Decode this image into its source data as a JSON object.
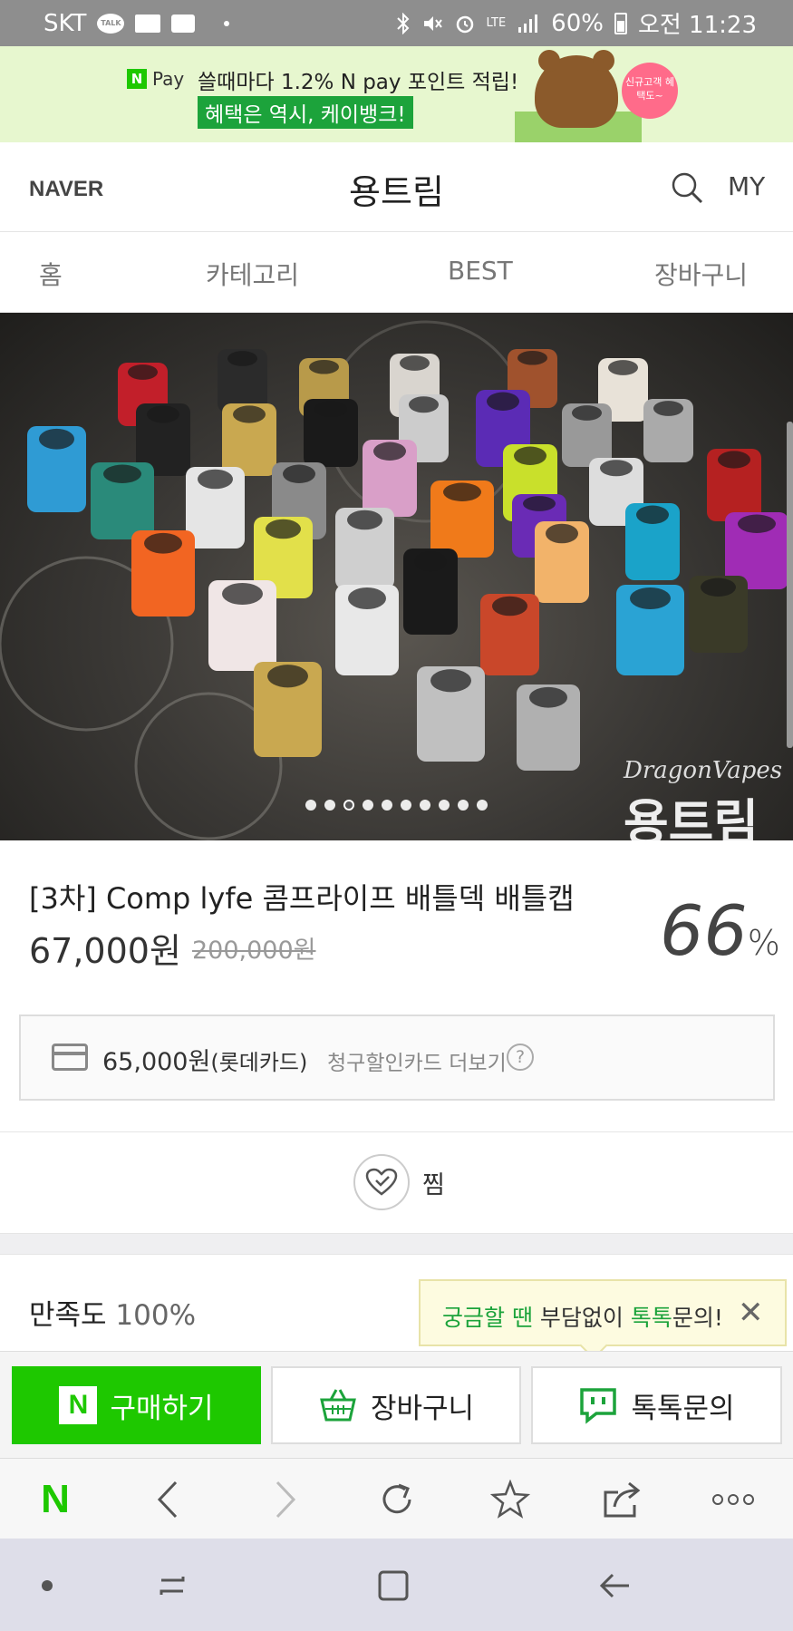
{
  "status_bar": {
    "carrier": "SKT",
    "talk_badge": "TALK",
    "network": "LTE",
    "battery": "60%",
    "time": "오전 11:23"
  },
  "ad_banner": {
    "npay_label": "Pay",
    "npay_n": "N",
    "line1": "쓸때마다 1.2% N pay 포인트 적립!",
    "line2": "혜택은 역시, 케이뱅크!",
    "bubble": "신규고객 혜택도~"
  },
  "header": {
    "logo": "NAVER",
    "title": "용트림",
    "my_label": "MY"
  },
  "nav_tabs": [
    {
      "label": "홈"
    },
    {
      "label": "카테고리"
    },
    {
      "label": "BEST"
    },
    {
      "label": "장바구니"
    }
  ],
  "hero": {
    "watermark_en": "DragonVapes",
    "watermark_ko": "용트림",
    "dot_count": 10,
    "active_dot": 3
  },
  "product": {
    "name": "[3차] Comp lyfe 콤프라이프 배틀덱 배틀캡",
    "price": "67,000원",
    "original_price": "200,000원",
    "discount": "66",
    "discount_unit": "%"
  },
  "card_promo": {
    "amount": "65,000원",
    "card_name": "(롯데카드)",
    "more_label": "청구할인카드 더보기",
    "help": "?"
  },
  "wish": {
    "label": "찜"
  },
  "satisfaction": {
    "label": "만족도",
    "value": "100%"
  },
  "tooltip": {
    "part1": "궁금할 땐",
    "part2": " 부담없이 ",
    "part3": "톡톡",
    "part4": "문의!",
    "close": "✕"
  },
  "actions": {
    "buy_label": "구매하기",
    "cart_label": "장바구니",
    "talk_label": "톡톡문의",
    "buy_icon": "N"
  },
  "browser_toolbar": {
    "home_logo": "N",
    "icons": [
      "back-icon",
      "forward-icon",
      "refresh-icon",
      "star-icon",
      "share-icon",
      "more-icon"
    ]
  },
  "colors": {
    "naver_green": "#1ec800",
    "ad_green": "#1ca33b",
    "status_bar": "#8e8e8e"
  }
}
